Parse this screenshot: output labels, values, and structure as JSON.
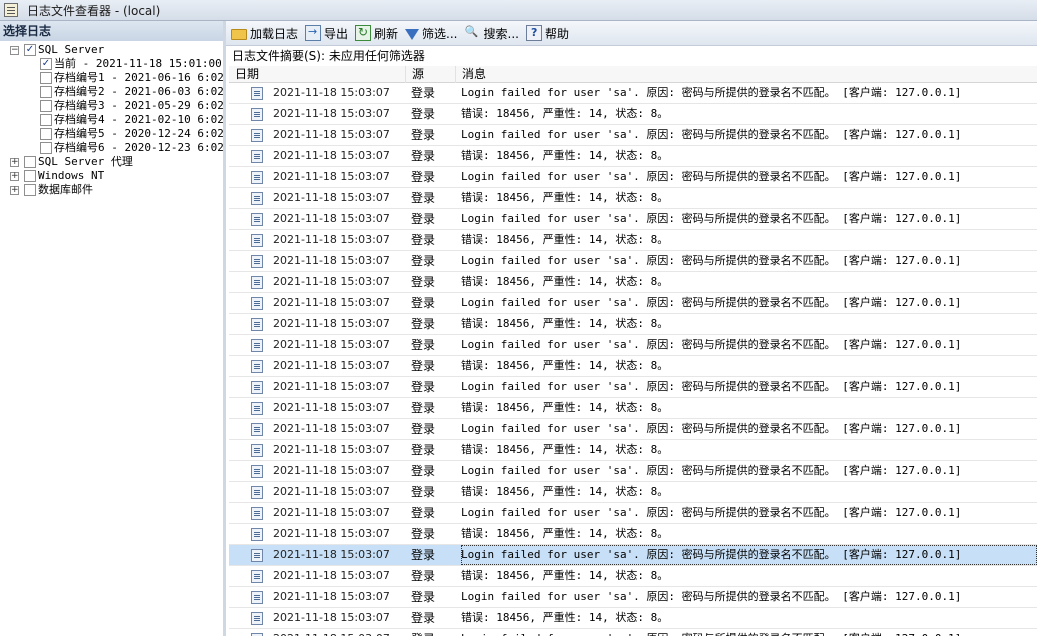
{
  "window": {
    "title": "日志文件查看器 - (local)"
  },
  "left_pane": {
    "header": "选择日志",
    "tree": [
      {
        "label": "SQL Server",
        "checked": true,
        "expander": "−"
      },
      {
        "label": "当前 - 2021-11-18 15:01:00",
        "checked": true
      },
      {
        "label": "存档编号1 - 2021-06-16 6:02:",
        "checked": false
      },
      {
        "label": "存档编号2 - 2021-06-03 6:02:",
        "checked": false
      },
      {
        "label": "存档编号3 - 2021-05-29 6:02:",
        "checked": false
      },
      {
        "label": "存档编号4 - 2021-02-10 6:02:",
        "checked": false
      },
      {
        "label": "存档编号5 - 2020-12-24 6:02:",
        "checked": false
      },
      {
        "label": "存档编号6 - 2020-12-23 6:02:",
        "checked": false
      },
      {
        "label": "SQL Server 代理",
        "checked": false,
        "expander": "+"
      },
      {
        "label": "Windows NT",
        "checked": false,
        "expander": "+"
      },
      {
        "label": "数据库邮件",
        "checked": false,
        "expander": "+"
      }
    ]
  },
  "toolbar": {
    "load_log": "加载日志",
    "export": "导出",
    "refresh": "刷新",
    "filter": "筛选...",
    "search": "搜索...",
    "help": "帮助"
  },
  "summary": "日志文件摘要(S): 未应用任何筛选器",
  "columns": {
    "date": "日期",
    "source": "源",
    "message": "消息"
  },
  "rows": [
    {
      "date": "2021-11-18 15:03:07",
      "source": "登录",
      "message": "Login failed for user 'sa'. 原因: 密码与所提供的登录名不匹配。 [客户端: 127.0.0.1]"
    },
    {
      "date": "2021-11-18 15:03:07",
      "source": "登录",
      "message": "错误: 18456, 严重性: 14, 状态: 8。"
    },
    {
      "date": "2021-11-18 15:03:07",
      "source": "登录",
      "message": "Login failed for user 'sa'. 原因: 密码与所提供的登录名不匹配。 [客户端: 127.0.0.1]"
    },
    {
      "date": "2021-11-18 15:03:07",
      "source": "登录",
      "message": "错误: 18456, 严重性: 14, 状态: 8。"
    },
    {
      "date": "2021-11-18 15:03:07",
      "source": "登录",
      "message": "Login failed for user 'sa'. 原因: 密码与所提供的登录名不匹配。 [客户端: 127.0.0.1]"
    },
    {
      "date": "2021-11-18 15:03:07",
      "source": "登录",
      "message": "错误: 18456, 严重性: 14, 状态: 8。"
    },
    {
      "date": "2021-11-18 15:03:07",
      "source": "登录",
      "message": "Login failed for user 'sa'. 原因: 密码与所提供的登录名不匹配。 [客户端: 127.0.0.1]"
    },
    {
      "date": "2021-11-18 15:03:07",
      "source": "登录",
      "message": "错误: 18456, 严重性: 14, 状态: 8。"
    },
    {
      "date": "2021-11-18 15:03:07",
      "source": "登录",
      "message": "Login failed for user 'sa'. 原因: 密码与所提供的登录名不匹配。 [客户端: 127.0.0.1]"
    },
    {
      "date": "2021-11-18 15:03:07",
      "source": "登录",
      "message": "错误: 18456, 严重性: 14, 状态: 8。"
    },
    {
      "date": "2021-11-18 15:03:07",
      "source": "登录",
      "message": "Login failed for user 'sa'. 原因: 密码与所提供的登录名不匹配。 [客户端: 127.0.0.1]"
    },
    {
      "date": "2021-11-18 15:03:07",
      "source": "登录",
      "message": "错误: 18456, 严重性: 14, 状态: 8。"
    },
    {
      "date": "2021-11-18 15:03:07",
      "source": "登录",
      "message": "Login failed for user 'sa'. 原因: 密码与所提供的登录名不匹配。 [客户端: 127.0.0.1]"
    },
    {
      "date": "2021-11-18 15:03:07",
      "source": "登录",
      "message": "错误: 18456, 严重性: 14, 状态: 8。"
    },
    {
      "date": "2021-11-18 15:03:07",
      "source": "登录",
      "message": "Login failed for user 'sa'. 原因: 密码与所提供的登录名不匹配。 [客户端: 127.0.0.1]"
    },
    {
      "date": "2021-11-18 15:03:07",
      "source": "登录",
      "message": "错误: 18456, 严重性: 14, 状态: 8。"
    },
    {
      "date": "2021-11-18 15:03:07",
      "source": "登录",
      "message": "Login failed for user 'sa'. 原因: 密码与所提供的登录名不匹配。 [客户端: 127.0.0.1]"
    },
    {
      "date": "2021-11-18 15:03:07",
      "source": "登录",
      "message": "错误: 18456, 严重性: 14, 状态: 8。"
    },
    {
      "date": "2021-11-18 15:03:07",
      "source": "登录",
      "message": "Login failed for user 'sa'. 原因: 密码与所提供的登录名不匹配。 [客户端: 127.0.0.1]"
    },
    {
      "date": "2021-11-18 15:03:07",
      "source": "登录",
      "message": "错误: 18456, 严重性: 14, 状态: 8。"
    },
    {
      "date": "2021-11-18 15:03:07",
      "source": "登录",
      "message": "Login failed for user 'sa'. 原因: 密码与所提供的登录名不匹配。 [客户端: 127.0.0.1]"
    },
    {
      "date": "2021-11-18 15:03:07",
      "source": "登录",
      "message": "错误: 18456, 严重性: 14, 状态: 8。"
    },
    {
      "date": "2021-11-18 15:03:07",
      "source": "登录",
      "message": "Login failed for user 'sa'. 原因: 密码与所提供的登录名不匹配。 [客户端: 127.0.0.1]",
      "selected": true
    },
    {
      "date": "2021-11-18 15:03:07",
      "source": "登录",
      "message": "错误: 18456, 严重性: 14, 状态: 8。"
    },
    {
      "date": "2021-11-18 15:03:07",
      "source": "登录",
      "message": "Login failed for user 'sa'. 原因: 密码与所提供的登录名不匹配。 [客户端: 127.0.0.1]"
    },
    {
      "date": "2021-11-18 15:03:07",
      "source": "登录",
      "message": "错误: 18456, 严重性: 14, 状态: 8。"
    },
    {
      "date": "2021-11-18 15:03:07",
      "source": "登录",
      "message": "Login failed for user 'sa'. 原因: 密码与所提供的登录名不匹配。 [客户端: 127.0.0.1]"
    }
  ]
}
